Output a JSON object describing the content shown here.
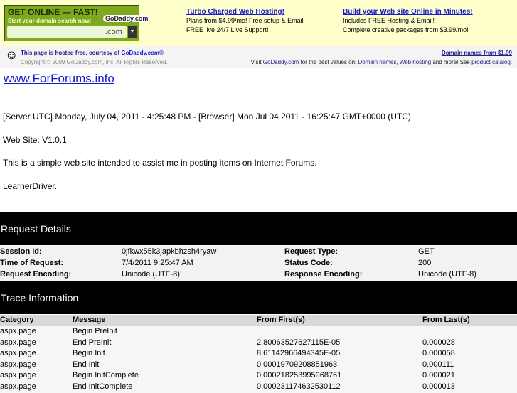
{
  "banner": {
    "ad_headline": "GET ONLINE — FAST!",
    "ad_sub": "Start your domain search now:",
    "ad_logo": "GoDaddy.com",
    "ad_tld": ".com",
    "col1": {
      "link": "Turbo Charged Web Hosting!",
      "line1": "Plans from $4.99/mo! Free setup & Email",
      "line2": "FREE live 24/7 Live Support!"
    },
    "col2": {
      "link": "Build your Web site Online in Minutes!",
      "line1": "Includes FREE Hosting & Email!",
      "line2": "Complete creative packages from $3.99/mo!"
    }
  },
  "hostbar": {
    "hosted": "This page is hosted free, courtesy of",
    "godaddy": "GoDaddy.com®",
    "copyright": "Copyright © 2009 GoDaddy.com, Inc. All Rights Reserved.",
    "domain_offer": "Domain names from $1.99",
    "visit": "Visit",
    "visit_link": "GoDaddy.com",
    "best": "for the best values on:",
    "domain_names": "Domain names",
    "web_hosting": "Web hosting",
    "more": "and more! See",
    "catalog": "product catalog."
  },
  "main": {
    "title": "www.ForForums.info",
    "time": "[Server UTC] Monday, July 04, 2011 - 4:25:48 PM - [Browser] Mon Jul 04 2011 - 16:25:47 GMT+0000 (UTC)",
    "version": "Web Site: V1.0.1",
    "desc": "This is a simple web site intended to assist me in posting items on Internet Forums.",
    "author": "LearnerDriver."
  },
  "request": {
    "heading": "Request Details",
    "session_label": "Session Id:",
    "session": "0jfkwx55k3japkbhzsh4ryaw",
    "type_label": "Request Type:",
    "type": "GET",
    "time_label": "Time of Request:",
    "time": "7/4/2011 9:25:47 AM",
    "status_label": "Status Code:",
    "status": "200",
    "enc_label": "Request Encoding:",
    "enc": "Unicode (UTF-8)",
    "resp_label": "Response Encoding:",
    "resp": "Unicode (UTF-8)"
  },
  "trace": {
    "heading": "Trace Information",
    "headers": [
      "Category",
      "Message",
      "From First(s)",
      "From Last(s)"
    ],
    "rows": [
      [
        "aspx.page",
        "Begin PreInit",
        "",
        ""
      ],
      [
        "aspx.page",
        "End PreInit",
        "2.80063527627115E-05",
        "0.000028"
      ],
      [
        "aspx.page",
        "Begin Init",
        "8.61142966494345E-05",
        "0.000058"
      ],
      [
        "aspx.page",
        "End Init",
        "0.00019709208851963",
        "0.000111"
      ],
      [
        "aspx.page",
        "Begin InitComplete",
        "0.000218253995968761",
        "0.000021"
      ],
      [
        "aspx.page",
        "End InitComplete",
        "0.000231174632530112",
        "0.000013"
      ]
    ]
  }
}
